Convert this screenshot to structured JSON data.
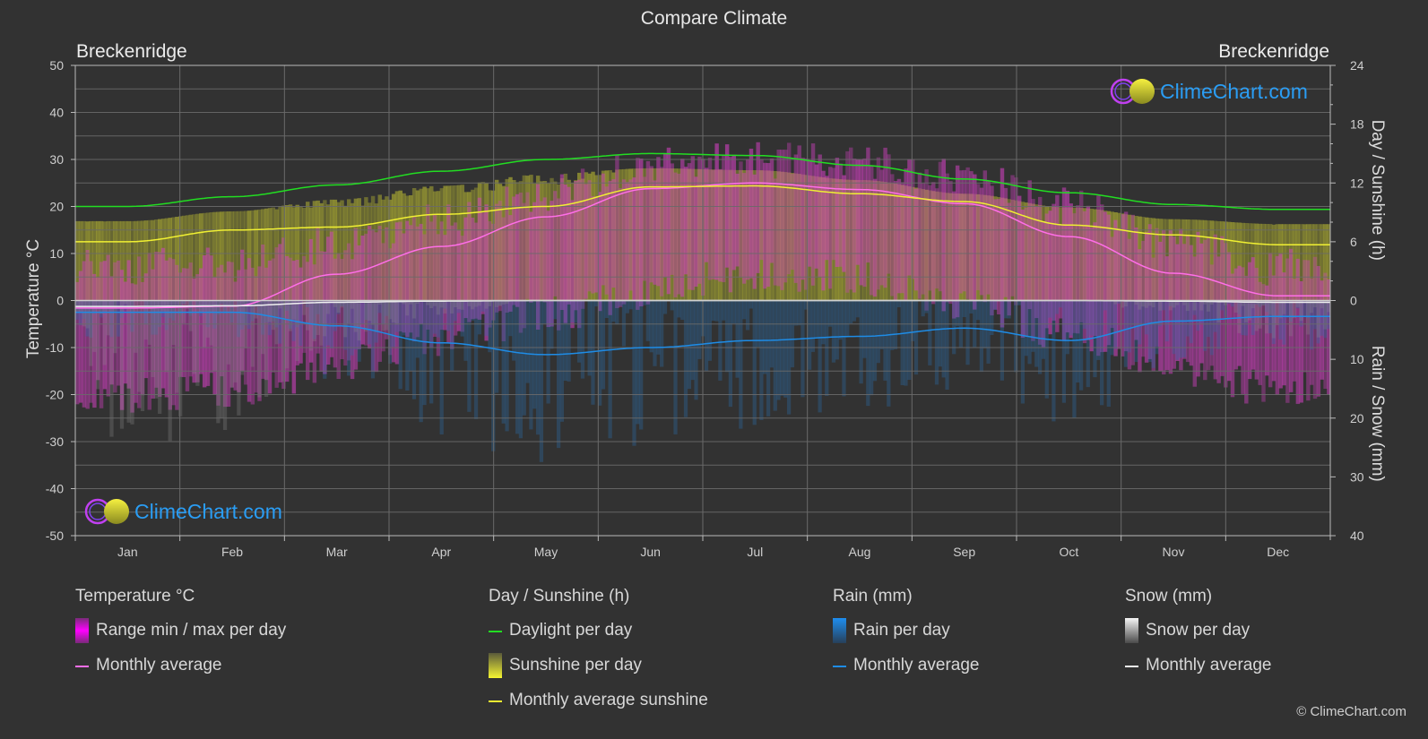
{
  "page": {
    "title": "Compare Climate",
    "location_left": "Breckenridge",
    "location_right": "Breckenridge",
    "copyright": "© ClimeChart.com",
    "logo_text": "ClimeChart.com"
  },
  "chart_data": {
    "type": "area",
    "title": "Compare Climate",
    "categories": [
      "Jan",
      "Feb",
      "Mar",
      "Apr",
      "May",
      "Jun",
      "Jul",
      "Aug",
      "Sep",
      "Oct",
      "Nov",
      "Dec"
    ],
    "axes": {
      "left": {
        "label": "Temperature °C",
        "min": -50,
        "max": 50,
        "ticks": [
          50,
          40,
          30,
          20,
          10,
          0,
          -10,
          -20,
          -30,
          -40,
          -50
        ]
      },
      "right_top": {
        "label": "Day / Sunshine (h)",
        "min": 0,
        "max": 24,
        "ticks": [
          24,
          18,
          12,
          6,
          0
        ]
      },
      "right_bottom": {
        "label": "Rain / Snow (mm)",
        "min": 0,
        "max": 40,
        "ticks": [
          0,
          10,
          20,
          30,
          40
        ]
      }
    },
    "grid": true,
    "series": [
      {
        "name": "Temperature monthly average",
        "unit": "°C",
        "axis": "left",
        "color": "#ff6ee8",
        "values": [
          -1.6,
          -1.2,
          5.6,
          11.5,
          17.8,
          23.8,
          25.0,
          23.6,
          20.6,
          13.6,
          5.8,
          1.0
        ]
      },
      {
        "name": "Daylight per day",
        "unit": "h",
        "axis": "right_top",
        "color": "#22dd22",
        "values": [
          9.6,
          10.6,
          11.8,
          13.2,
          14.4,
          15.0,
          14.8,
          13.8,
          12.4,
          11.0,
          9.8,
          9.3
        ]
      },
      {
        "name": "Monthly average sunshine",
        "unit": "h",
        "axis": "right_top",
        "color": "#f0f032",
        "values": [
          6.0,
          7.2,
          7.5,
          8.8,
          9.6,
          11.6,
          11.7,
          10.9,
          10.1,
          7.7,
          6.7,
          5.7
        ]
      },
      {
        "name": "Rain monthly average",
        "unit": "mm",
        "axis": "right_bottom",
        "color": "#1e8ce6",
        "values": [
          2.0,
          2.0,
          4.3,
          7.2,
          9.2,
          8.0,
          6.8,
          6.1,
          4.7,
          6.8,
          3.5,
          2.7
        ]
      },
      {
        "name": "Snow monthly average",
        "unit": "mm",
        "axis": "right_bottom",
        "color": "#f0f0f0",
        "values": [
          1.0,
          0.9,
          0.3,
          0.1,
          0.0,
          0.0,
          0.0,
          0.0,
          0.0,
          0.0,
          0.1,
          0.3
        ]
      }
    ],
    "temperature_range_band": {
      "name": "Range min / max per day",
      "max_values": [
        7,
        8,
        12,
        17,
        23,
        29,
        30,
        29,
        26,
        20,
        12,
        7
      ],
      "min_values": [
        -20,
        -19,
        -14,
        -8,
        -3,
        2,
        6,
        5,
        0,
        -7,
        -14,
        -19
      ]
    },
    "legend": {
      "placement": "bottom",
      "groups": [
        {
          "title": "Temperature °C",
          "items": [
            {
              "label": "Range min / max per day",
              "kind": "bar",
              "color": "#e600e6"
            },
            {
              "label": "Monthly average",
              "kind": "line",
              "color": "#ff6ee8"
            }
          ]
        },
        {
          "title": "Day / Sunshine (h)",
          "items": [
            {
              "label": "Daylight per day",
              "kind": "line",
              "color": "#22dd22"
            },
            {
              "label": "Sunshine per day",
              "kind": "bar",
              "color": "#e8e832"
            },
            {
              "label": "Monthly average sunshine",
              "kind": "line",
              "color": "#f0f032"
            }
          ]
        },
        {
          "title": "Rain (mm)",
          "items": [
            {
              "label": "Rain per day",
              "kind": "bar",
              "color": "#1e8ce6"
            },
            {
              "label": "Monthly average",
              "kind": "line",
              "color": "#1e8ce6"
            }
          ]
        },
        {
          "title": "Snow (mm)",
          "items": [
            {
              "label": "Snow per day",
              "kind": "bar",
              "color": "#e6e6e6"
            },
            {
              "label": "Monthly average",
              "kind": "line",
              "color": "#f0f0f0"
            }
          ]
        }
      ]
    }
  }
}
